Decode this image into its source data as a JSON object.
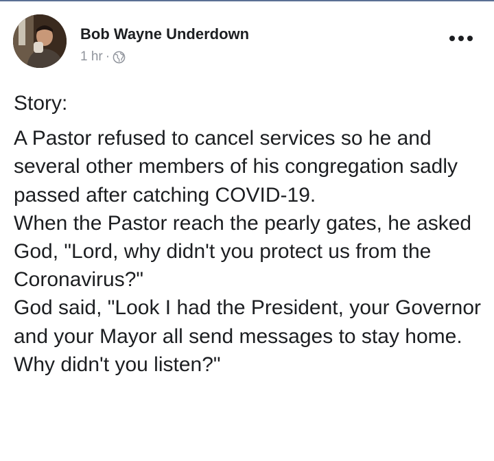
{
  "post": {
    "author": "Bob Wayne Underdown",
    "time": "1 hr",
    "separator": "·",
    "privacy_icon": "globe-icon",
    "more_icon": "more-options-icon",
    "heading": "Story:",
    "paragraphs": [
      "A Pastor refused to cancel services so he and several other members of his congregation sadly passed after catching COVID-19.",
      "When the Pastor reach the pearly gates, he asked God, \"Lord, why didn't you protect us from the Coronavirus?\"",
      "God said, \"Look I had the President, your Governor and your Mayor all send messages to stay home. Why didn't you listen?\""
    ]
  }
}
